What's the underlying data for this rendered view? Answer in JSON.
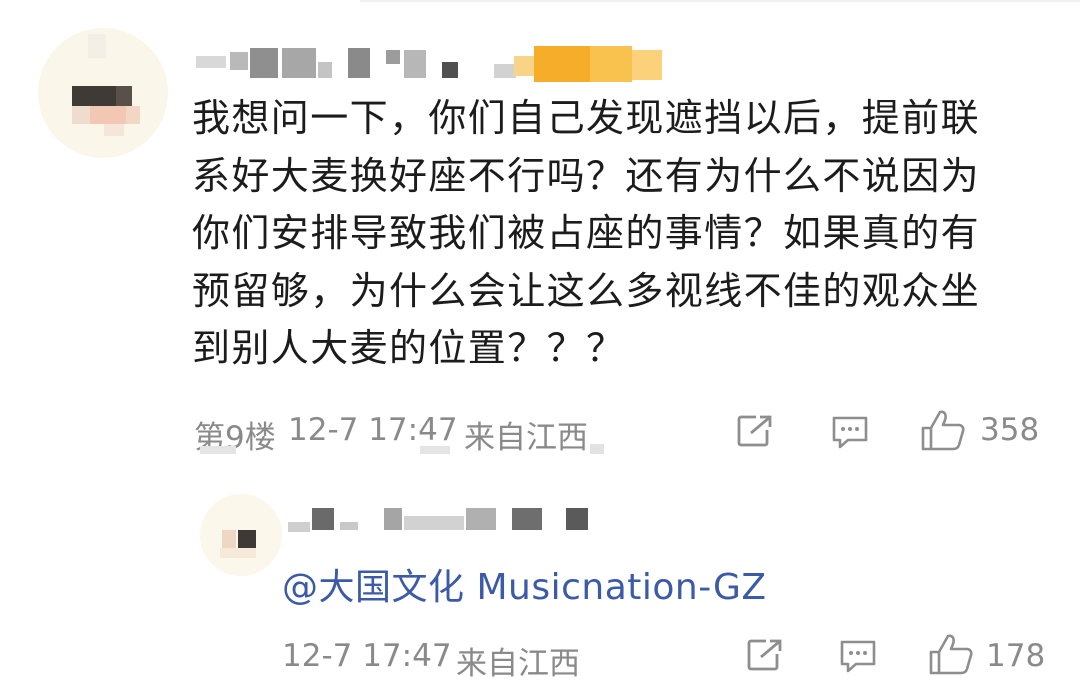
{
  "comment": {
    "lines": [
      "我想问一下，你们自己发现遮挡以后，提前联",
      "系好大麦换好座不行吗？还有为什么不说因为",
      "你们安排导致我们被占座的事情？如果真的有",
      "预留够，为什么会让这么多视线不佳的观众坐",
      "到别人大麦的位置？？？"
    ],
    "floor": "第9楼",
    "timestamp": "12-7 17:47",
    "location": "来自江西",
    "like_count": "358",
    "icons": {
      "share": "share-icon",
      "comment": "comment-icon",
      "like": "thumbs-up-icon"
    }
  },
  "reply": {
    "mention": "@大国文化 Musicnation-GZ",
    "timestamp": "12-7 17:47",
    "location": "来自江西",
    "like_count": "178",
    "icons": {
      "share": "share-icon",
      "comment": "comment-icon",
      "like": "thumbs-up-icon"
    }
  },
  "colors": {
    "mention": "#3b5aa8",
    "meta": "#8a8a8a",
    "text": "#1c1c1c",
    "badge": "#f7b73a"
  }
}
